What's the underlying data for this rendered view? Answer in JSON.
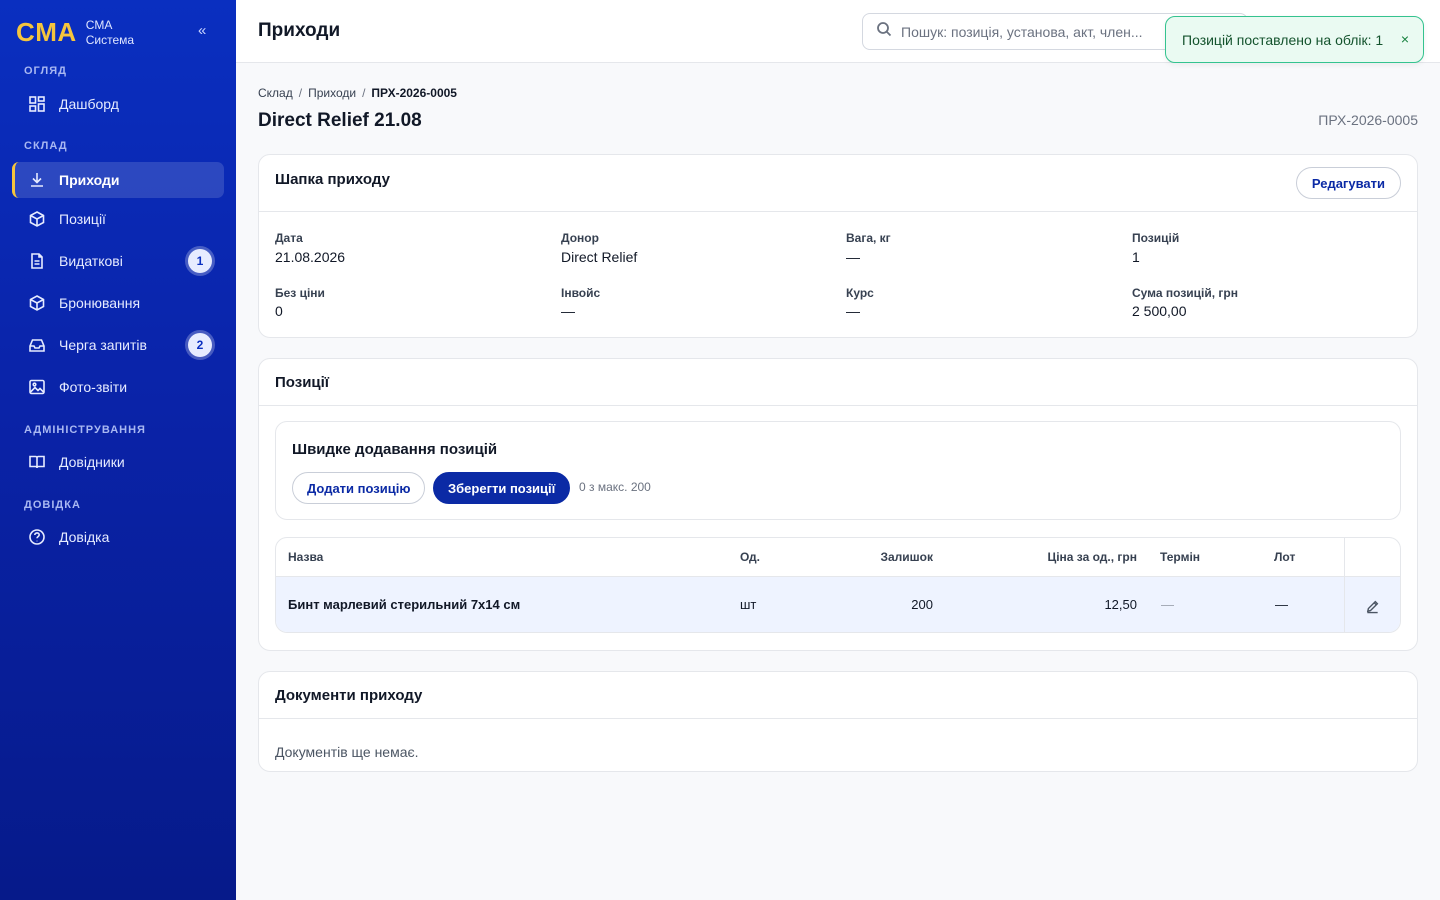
{
  "sidebar": {
    "brand_logo": "CMA",
    "brand_line1": "CMA",
    "brand_line2": "Система",
    "collapse_label": "«",
    "sections": {
      "overview": "ОГЛЯД",
      "warehouse": "СКЛАД",
      "admin": "АДМІНІСТРУВАННЯ",
      "help": "ДОВІДКА"
    },
    "items": [
      {
        "label": "Дашборд",
        "icon": "dashboard-icon"
      },
      {
        "label": "Приходи",
        "icon": "download-icon",
        "active": true
      },
      {
        "label": "Позиції",
        "icon": "box-icon"
      },
      {
        "label": "Видаткові",
        "icon": "document-icon",
        "badge": "1"
      },
      {
        "label": "Бронювання",
        "icon": "box-icon"
      },
      {
        "label": "Черга запитів",
        "icon": "inbox-icon",
        "badge": "2"
      },
      {
        "label": "Фото-звіти",
        "icon": "image-icon"
      },
      {
        "label": "Довідники",
        "icon": "book-icon"
      },
      {
        "label": "Довідка",
        "icon": "help-icon"
      }
    ]
  },
  "topbar": {
    "title": "Приходи",
    "search_placeholder": "Пошук: позиція, установа, акт, член..."
  },
  "toast": {
    "message": "Позицій поставлено на облік: 1",
    "close": "×"
  },
  "breadcrumb": [
    "Склад",
    "Приходи",
    "ПРХ-2026-0005"
  ],
  "breadcrumb_sep": "/",
  "page": {
    "title": "Direct Relief 21.08",
    "code": "ПРХ-2026-0005"
  },
  "header_card": {
    "title": "Шапка приходу",
    "edit_label": "Редагувати",
    "fields": [
      {
        "label": "Дата",
        "value": "21.08.2026"
      },
      {
        "label": "Донор",
        "value": "Direct Relief"
      },
      {
        "label": "Вага, кг",
        "value": "—"
      },
      {
        "label": "Позицій",
        "value": "1"
      },
      {
        "label": "Без ціни",
        "value": "0"
      },
      {
        "label": "Інвойс",
        "value": "—"
      },
      {
        "label": "Курс",
        "value": "—"
      },
      {
        "label": "Сума позицій, грн",
        "value": "2 500,00"
      }
    ]
  },
  "positions_card": {
    "title": "Позиції",
    "quick_title": "Швидке додавання позицій",
    "add_label": "Додати позицію",
    "save_label": "Зберегти позиції",
    "counter": "0 з макс. 200",
    "columns": [
      "Назва",
      "Од.",
      "Залишок",
      "Ціна за од., грн",
      "Термін",
      "Лот"
    ],
    "rows": [
      {
        "name": "Бинт марлевий стерильний 7х14 см",
        "unit": "шт",
        "stock": "200",
        "price": "12,50",
        "term": "—",
        "lot": "—"
      }
    ]
  },
  "documents_card": {
    "title": "Документи приходу",
    "empty": "Документів ще немає."
  }
}
